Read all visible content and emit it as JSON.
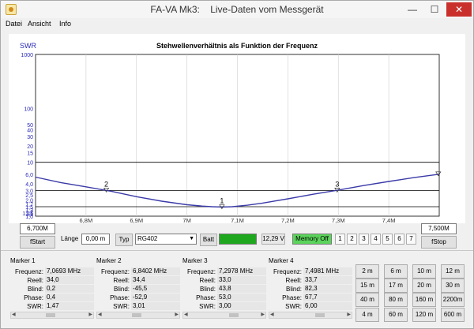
{
  "window": {
    "title": "FA-VA Mk3:    Live-Daten vom Messgerät",
    "minimize": "—",
    "maximize": "☐",
    "close": "✕",
    "app_icon": "app-logo-icon"
  },
  "menu": [
    "Datei",
    "Ansicht",
    "Info"
  ],
  "chart": {
    "title": "Stehwellenverhältnis als Funktion der Frequenz",
    "ylabel": "SWR"
  },
  "chart_data": {
    "type": "line",
    "title": "Stehwellenverhältnis als Funktion der Frequenz",
    "ylabel": "SWR",
    "xlabel": "",
    "y_scale": "log",
    "xlim": [
      6.7,
      7.5
    ],
    "ylim": [
      1.0,
      1000
    ],
    "x_ticks": [
      6.8,
      6.9,
      7.0,
      7.1,
      7.2,
      7.3,
      7.4
    ],
    "x_tick_labels": [
      "6,8M",
      "6,9M",
      "7M",
      "7,1M",
      "7,2M",
      "7,3M",
      "7,4M"
    ],
    "y_ticks": [
      1.0,
      1.1,
      1.15,
      1.2,
      1.3,
      1.5,
      1.7,
      2.0,
      2.5,
      3.0,
      4.0,
      6.0,
      10,
      15,
      20,
      30,
      40,
      50,
      100,
      1000
    ],
    "y_tick_labels": [
      "1,0",
      "1,1",
      "1,15",
      "1,2",
      "1,3",
      "1,5",
      "1,7",
      "2,0",
      "2,5",
      "3,0",
      "4,0",
      "6,0",
      "10",
      "15",
      "20",
      "30",
      "40",
      "50",
      "100",
      "1000"
    ],
    "major_gridlines": [
      1.5,
      3.0,
      10
    ],
    "series": [
      {
        "color": "#3a3aa8",
        "x": [
          6.7,
          6.75,
          6.8,
          6.85,
          6.9,
          6.95,
          7.0,
          7.03,
          7.05,
          7.07,
          7.09,
          7.12,
          7.15,
          7.2,
          7.25,
          7.3,
          7.35,
          7.4,
          7.45,
          7.5
        ],
        "y": [
          5.3,
          4.2,
          3.5,
          2.9,
          2.3,
          1.9,
          1.63,
          1.54,
          1.5,
          1.48,
          1.5,
          1.6,
          1.75,
          2.1,
          2.55,
          3.05,
          3.7,
          4.4,
          5.2,
          6.0
        ]
      }
    ],
    "markers": [
      {
        "label": "2",
        "x": 6.8402,
        "y": 3.01
      },
      {
        "label": "1",
        "x": 7.0693,
        "y": 1.47
      },
      {
        "label": "3",
        "x": 7.2978,
        "y": 3.0
      },
      {
        "label": "",
        "x": 7.4981,
        "y": 6.0
      }
    ]
  },
  "controls": {
    "fstart_value": "6,700M",
    "fstop_value": "7,500M",
    "fstart_button": "fStart",
    "fstop_button": "fStop",
    "laenge_label": "Länge",
    "laenge_value": "0,00 m",
    "typ_button": "Typ",
    "typ_value": "RG402",
    "batt_button": "Batt",
    "battery_level_percent": 100,
    "voltage": "12,29 V",
    "memory": "Memory Off",
    "memory_slots": [
      "1",
      "2",
      "3",
      "4",
      "5",
      "6",
      "7"
    ]
  },
  "markers": [
    {
      "title": "Marker 1",
      "frequenz": "7,0693 MHz",
      "reell": "34,0",
      "blind": "0,2",
      "phase": "0,4",
      "swr": "1,47"
    },
    {
      "title": "Marker 2",
      "frequenz": "6,8402 MHz",
      "reell": "34,4",
      "blind": "-45,5",
      "phase": "-52,9",
      "swr": "3,01"
    },
    {
      "title": "Marker 3",
      "frequenz": "7,2978 MHz",
      "reell": "33,0",
      "blind": "43,8",
      "phase": "53,0",
      "swr": "3,00"
    },
    {
      "title": "Marker 4",
      "frequenz": "7,4981 MHz",
      "reell": "33,7",
      "blind": "82,3",
      "phase": "67,7",
      "swr": "6,00"
    }
  ],
  "marker_labels": {
    "frequenz": "Frequenz:",
    "reell": "Reell:",
    "blind": "Blind:",
    "phase": "Phase:",
    "swr": "SWR:"
  },
  "bands": [
    "2 m",
    "6 m",
    "10 m",
    "12 m",
    "15 m",
    "17 m",
    "20 m",
    "30 m",
    "40 m",
    "80 m",
    "160 m",
    "2200m",
    "4 m",
    "60 m",
    "120 m",
    "600 m"
  ]
}
